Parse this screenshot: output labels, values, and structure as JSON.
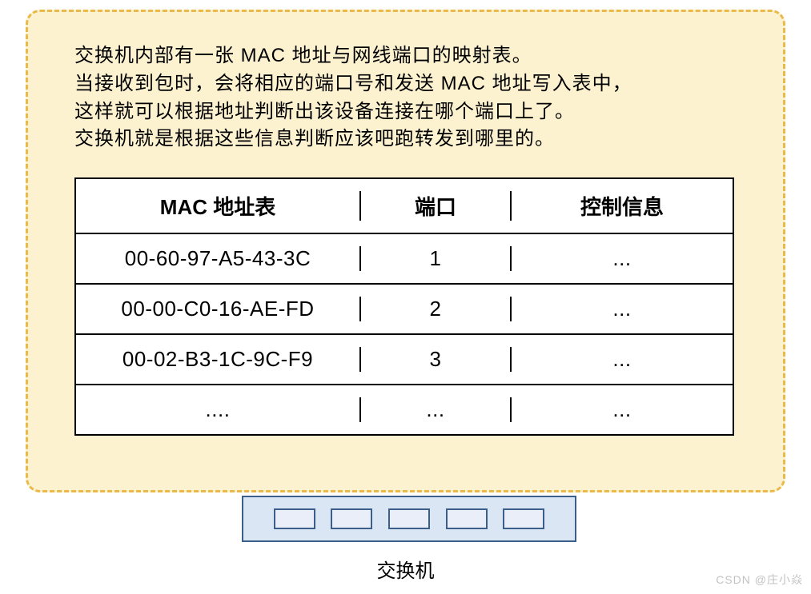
{
  "description": {
    "line1": "交换机内部有一张 MAC 地址与网线端口的映射表。",
    "line2": "当接收到包时，会将相应的端口号和发送 MAC 地址写入表中，",
    "line3": "这样就可以根据地址判断出该设备连接在哪个端口上了。",
    "line4": "交换机就是根据这些信息判断应该吧跑转发到哪里的。"
  },
  "table": {
    "headers": {
      "mac": "MAC 地址表",
      "port": "端口",
      "ctrl": "控制信息"
    },
    "rows": [
      {
        "mac": "00-60-97-A5-43-3C",
        "port": "1",
        "ctrl": "..."
      },
      {
        "mac": "00-00-C0-16-AE-FD",
        "port": "2",
        "ctrl": "..."
      },
      {
        "mac": "00-02-B3-1C-9C-F9",
        "port": "3",
        "ctrl": "..."
      },
      {
        "mac": "....",
        "port": "...",
        "ctrl": "..."
      }
    ]
  },
  "switch": {
    "label": "交换机",
    "port_count": 5
  },
  "watermark": "CSDN @庄小焱"
}
